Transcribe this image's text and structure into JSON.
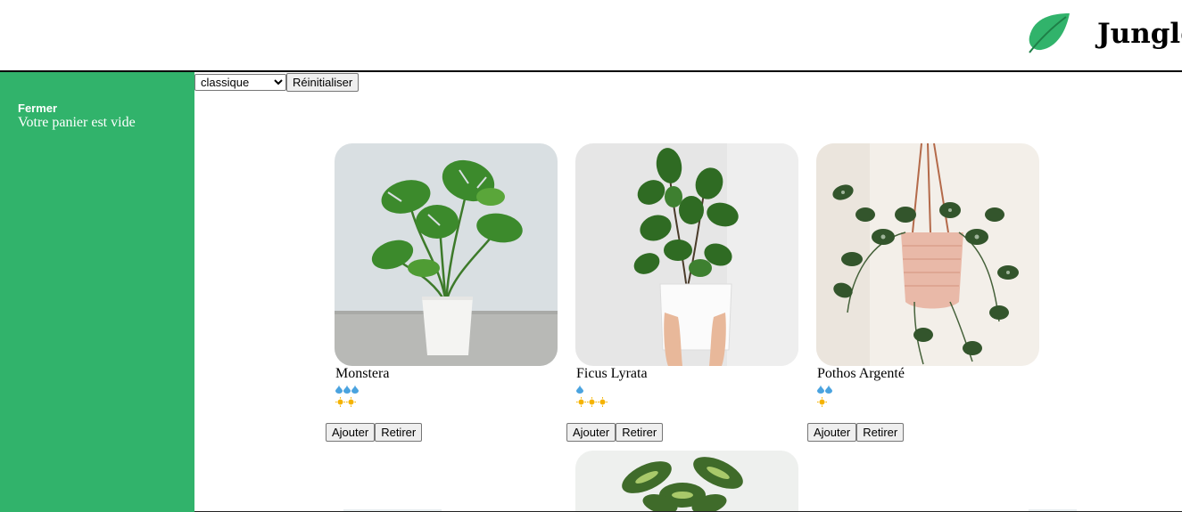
{
  "banner": {
    "title": "Jungle",
    "logo_icon": "leaf-icon",
    "colors": {
      "leaf": "#31b36b"
    }
  },
  "cart": {
    "close_label": "Fermer",
    "empty_message": "Votre panier est vide",
    "background": "#31b36b"
  },
  "filters": {
    "category_selected": "classique",
    "reset_label": "Réinitialiser"
  },
  "plants": [
    {
      "name": "Monstera",
      "water": 3,
      "light": 2,
      "add_label": "Ajouter",
      "remove_label": "Retirer"
    },
    {
      "name": "Ficus Lyrata",
      "water": 1,
      "light": 3,
      "add_label": "Ajouter",
      "remove_label": "Retirer"
    },
    {
      "name": "Pothos Argenté",
      "water": 2,
      "light": 1,
      "add_label": "Ajouter",
      "remove_label": "Retirer"
    }
  ],
  "care_icons": {
    "water": "water-drop-icon",
    "light": "sun-icon"
  }
}
